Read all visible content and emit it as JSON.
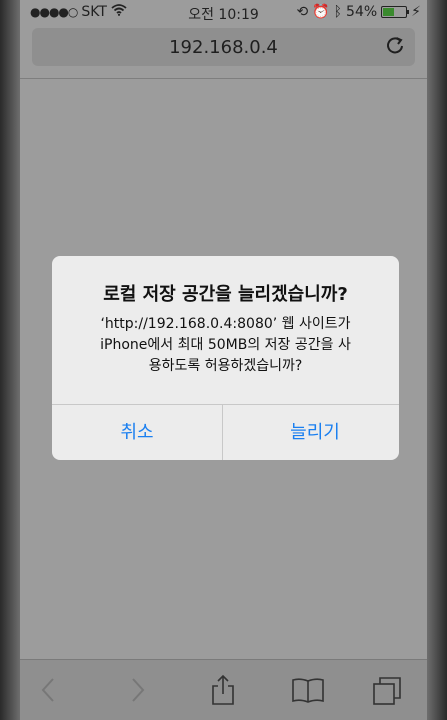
{
  "status_bar": {
    "carrier": "SKT",
    "time": "오전 10:19",
    "battery": "54%",
    "battery_level": 0.54
  },
  "address_bar": {
    "url": "192.168.0.4"
  },
  "alert": {
    "title": "로컬 저장 공간을 늘리겠습니까?",
    "message_lines": [
      "‘http://192.168.0.4:8080’ 웹 사이트가",
      "iPhone에서 최대 50MB의 저장 공간을 사",
      "용하도록 허용하겠습니까?"
    ],
    "cancel_label": "취소",
    "confirm_label": "늘리기"
  },
  "toolbar": {
    "items": [
      "back-icon",
      "forward-icon",
      "share-icon",
      "bookmarks-icon",
      "tabs-icon"
    ]
  }
}
